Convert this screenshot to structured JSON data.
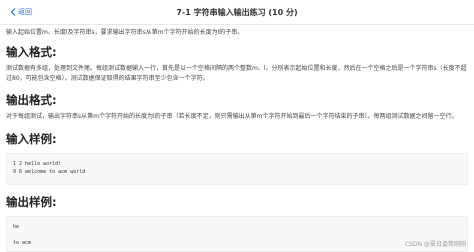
{
  "header": {
    "back_label": "返回",
    "title": "7-1 字符串输入输出练习 (10 分)"
  },
  "problem": {
    "intro": "输入起始位置m、长度l及字符串s，要求输出字符串s从第m个字符开始的长度为l的子串。",
    "input_heading": "输入格式:",
    "input_desc": "测试数据有多组，处理到文件尾。每组测试数据输入一行，首先是以一个空格间隔的两个整数m、l，分别表示起始位置和长度，然后在一个空格之后是一个字符串s（长度不超过80，可能包含空格）。测试数据保证取得的结果字符串至少包含一个字符。",
    "output_heading": "输出格式:",
    "output_desc": "对于每组测试，输出字符串s从第m个字符开始的长度为l的子串（若长度不足，则只需输出从第m个字符开始到最后一个字符结束的子串）。每两组测试数据之间留一空行。",
    "sample_input_heading": "输入样例:",
    "sample_input_lines": [
      "1 2 hello world!",
      "9 6 welcome to acm world"
    ],
    "sample_output_heading": "输出样例:",
    "sample_output_lines": [
      "he",
      "",
      "to acm"
    ]
  },
  "watermark": "CSDN @夏日姿势刚刚"
}
